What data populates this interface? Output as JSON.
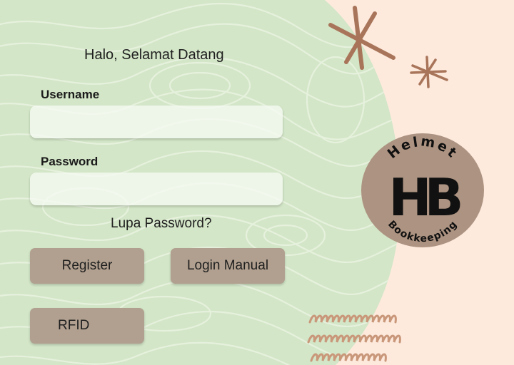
{
  "greeting": "Halo, Selamat Datang",
  "username": {
    "label": "Username",
    "value": "",
    "placeholder": ""
  },
  "password": {
    "label": "Password",
    "value": "",
    "placeholder": ""
  },
  "forgot_password": "Lupa Password?",
  "buttons": {
    "register": "Register",
    "login_manual": "Login Manual",
    "rfid": "RFID"
  },
  "logo": {
    "top_text": "Helmet",
    "monogram": "HB",
    "bottom_text": "Bookkeeping"
  },
  "colors": {
    "background": "#fdeadd",
    "panel_green": "#d3e6c7",
    "contour_lines": "#e6f1dd",
    "button": "#b1a08f",
    "logo_circle": "#ad9381",
    "accent_brown": "#a9755a"
  },
  "icons": [
    "star-doodle-icon",
    "squiggle-doodle-icon"
  ]
}
